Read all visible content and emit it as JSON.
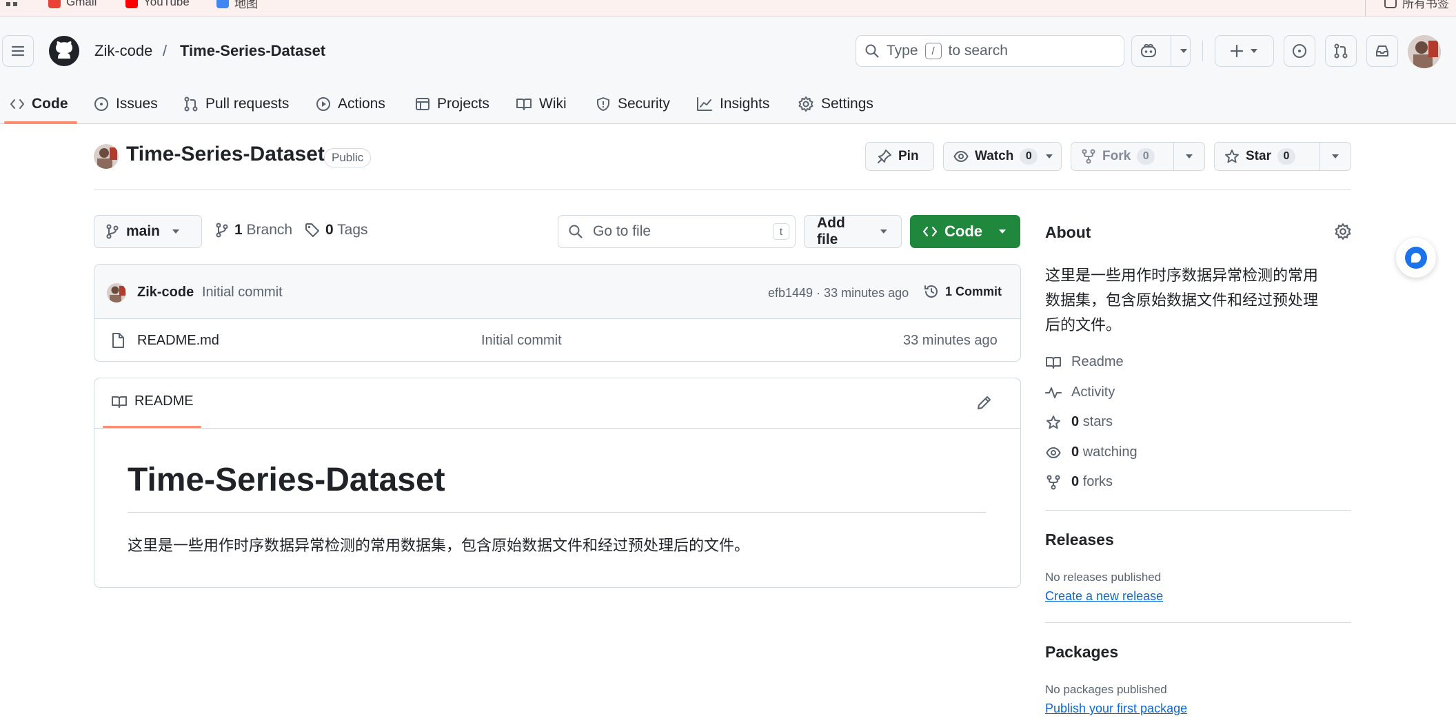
{
  "browser": {
    "bookmarks": [
      {
        "label": "Gmail",
        "icon": "gmail-icon"
      },
      {
        "label": "YouTube",
        "icon": "youtube-icon"
      },
      {
        "label": "地图",
        "icon": "maps-icon"
      }
    ],
    "right_label": "所有书签"
  },
  "header": {
    "owner": "Zik-code",
    "separator": "/",
    "repo": "Time-Series-Dataset",
    "search": {
      "prefix": "Type",
      "key": "/",
      "suffix": "to search"
    }
  },
  "tabs": [
    {
      "label": "Code",
      "icon": "code-icon"
    },
    {
      "label": "Issues",
      "icon": "issue-icon"
    },
    {
      "label": "Pull requests",
      "icon": "pull-request-icon"
    },
    {
      "label": "Actions",
      "icon": "play-icon"
    },
    {
      "label": "Projects",
      "icon": "table-icon"
    },
    {
      "label": "Wiki",
      "icon": "book-icon"
    },
    {
      "label": "Security",
      "icon": "shield-icon"
    },
    {
      "label": "Insights",
      "icon": "graph-icon"
    },
    {
      "label": "Settings",
      "icon": "gear-icon"
    }
  ],
  "repo": {
    "title": "Time-Series-Dataset",
    "visibility": "Public",
    "pin_label": "Pin",
    "watch_label": "Watch",
    "watch_count": "0",
    "fork_label": "Fork",
    "fork_count": "0",
    "star_label": "Star",
    "star_count": "0"
  },
  "toolbar": {
    "branch": "main",
    "branch_count": "1",
    "branch_label": "Branch",
    "tag_count": "0",
    "tag_label": "Tags",
    "goto_placeholder": "Go to file",
    "goto_key": "t",
    "add_file_label": "Add file",
    "code_label": "Code"
  },
  "commit": {
    "author": "Zik-code",
    "message": "Initial commit",
    "meta": "efb1449 · 33 minutes ago",
    "count_label": "1 Commit"
  },
  "files": [
    {
      "name": "README.md",
      "message": "Initial commit",
      "time": "33 minutes ago"
    }
  ],
  "readme": {
    "tab_label": "README",
    "heading": "Time-Series-Dataset",
    "body": "这里是一些用作时序数据异常检测的常用数据集，包含原始数据文件和经过预处理后的文件。"
  },
  "about": {
    "title": "About",
    "description_lines": [
      "这里是一些用作时序数据异常检测的常用",
      "数据集，包含原始数据文件和经过预处理",
      "后的文件。"
    ],
    "readme_label": "Readme",
    "activity_label": "Activity",
    "stars_count": "0",
    "stars_label": "stars",
    "watching_count": "0",
    "watching_label": "watching",
    "forks_count": "0",
    "forks_label": "forks"
  },
  "releases": {
    "title": "Releases",
    "empty": "No releases published",
    "link": "Create a new release"
  },
  "packages": {
    "title": "Packages",
    "empty": "No packages published",
    "link": "Publish your first package"
  },
  "colors": {
    "accent_green": "#1f883d",
    "tab_underline": "#fd8c73",
    "link_blue": "#0969da",
    "border": "#d1d9e0"
  }
}
